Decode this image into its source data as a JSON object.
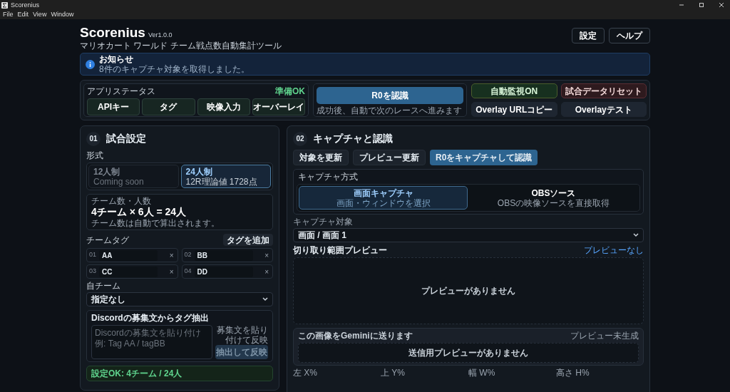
{
  "window": {
    "title": "Scorenius"
  },
  "menu": [
    "File",
    "Edit",
    "View",
    "Window"
  ],
  "header": {
    "title": "Scorenius",
    "version": "Ver1.0.0",
    "subtitle": "マリオカート ワールド チーム戦点数自動集計ツール",
    "buttons": [
      "設定",
      "ヘルプ"
    ]
  },
  "notice": {
    "title": "お知らせ",
    "message": "8件のキャプチャ対象を取得しました。"
  },
  "app_status": {
    "label": "アプリステータス",
    "status": "準備OK",
    "items": [
      "APIキー",
      "タグ",
      "映像入力",
      "オーバーレイ"
    ]
  },
  "recognize": {
    "button": "R0を認識",
    "hint": "成功後、自動で次のレースへ進みます"
  },
  "actions": [
    {
      "label": "自動監視ON",
      "kind": "success"
    },
    {
      "label": "試合データリセット",
      "kind": "danger"
    },
    {
      "label": "Overlay URLコピー",
      "kind": "neutral"
    },
    {
      "label": "Overlayテスト",
      "kind": "neutral"
    }
  ],
  "match_settings": {
    "number": "01",
    "title": "試合設定",
    "format_label": "形式",
    "formats": [
      {
        "title": "12人制",
        "subtitle": "Coming soon",
        "selected": false
      },
      {
        "title": "24人制",
        "subtitle": "12R理論値 1728点",
        "selected": true
      }
    ],
    "team_count": {
      "label": "チーム数・人数",
      "value": "4チーム × 6人 = 24人",
      "note": "チーム数は自動で算出されます。"
    },
    "team_tags_label": "チームタグ",
    "add_tag_button": "タグを追加",
    "tags": [
      {
        "index": "01",
        "value": "AA",
        "remove": "×"
      },
      {
        "index": "02",
        "value": "BB",
        "remove": "×"
      },
      {
        "index": "03",
        "value": "CC",
        "remove": "×"
      },
      {
        "index": "04",
        "value": "DD",
        "remove": "×"
      }
    ],
    "own_team": {
      "label": "自チーム",
      "value": "指定なし"
    },
    "discord": {
      "title": "Discordの募集文からタグ抽出",
      "hint": "募集文を貼り付けて反映",
      "placeholder": [
        "Discordの募集文を貼り付け",
        "例: Tag AA / tagBB"
      ],
      "button": "抽出して反映"
    },
    "status_message": "設定OK: 4チーム / 24人"
  },
  "capture": {
    "number": "02",
    "title": "キャプチャと認識",
    "buttons": [
      {
        "label": "対象を更新",
        "primary": false
      },
      {
        "label": "プレビュー更新",
        "primary": false
      },
      {
        "label": "R0をキャプチャして認識",
        "primary": true
      }
    ],
    "method_label": "キャプチャ方式",
    "methods": [
      {
        "title": "画面キャプチャ",
        "subtitle": "画面・ウィンドウを選択",
        "selected": true
      },
      {
        "title": "OBSソース",
        "subtitle": "OBSの映像ソースを直接取得",
        "selected": false
      }
    ],
    "target": {
      "label": "キャプチャ対象",
      "value": "画面 / 画面 1"
    },
    "preview": {
      "title": "切り取り範囲プレビュー",
      "status": "プレビューなし",
      "empty": "プレビューがありません"
    },
    "gemini": {
      "title": "この画像をGeminiに送ります",
      "status": "プレビュー未生成",
      "empty": "送信用プレビューがありません"
    },
    "crop_fields": [
      "左 X%",
      "上 Y%",
      "幅 W%",
      "高さ H%"
    ]
  }
}
